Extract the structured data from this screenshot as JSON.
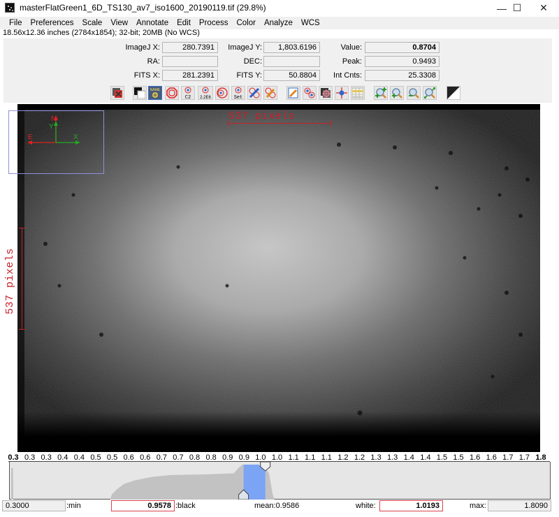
{
  "window": {
    "title": "masterFlatGreen1_6D_TS130_av7_iso1600_20190119.tif (29.8%)",
    "minimize": "—",
    "maximize": "☐",
    "close": "✕"
  },
  "menu": [
    "File",
    "Preferences",
    "Scale",
    "View",
    "Annotate",
    "Edit",
    "Process",
    "Color",
    "Analyze",
    "WCS"
  ],
  "info_line": "18.56x12.36 inches (2784x1854); 32-bit; 20MB (No WCS)",
  "coords": {
    "imagej_x_label": "ImageJ X:",
    "imagej_x": "280.7391",
    "imagej_y_label": "ImageJ Y:",
    "imagej_y": "1,803.6196",
    "value_label": "Value:",
    "value": "0.8704",
    "ra_label": "RA:",
    "ra": "",
    "dec_label": "DEC:",
    "dec": "",
    "peak_label": "Peak:",
    "peak": "0.9493",
    "fits_x_label": "FITS X:",
    "fits_x": "281.2391",
    "fits_y_label": "FITS Y:",
    "fits_y": "50.8804",
    "int_cnts_label": "Int Cnts:",
    "int_cnts": "25.3308"
  },
  "toolbar": {
    "icons": [
      "clear-overlay-icon",
      "color-swap-icon",
      "name-label-icon",
      "octagon-aperture-icon",
      "aperture-c2-icon",
      "aperture-2266-icon",
      "aperture-offset-icon",
      "aperture-set-icon",
      "edit-apertures-icon",
      "clear-apertures-icon",
      "clear-measurements-icon",
      "multi-aperture-icon",
      "align-stack-icon",
      "centroid-icon",
      "measurements-table-icon",
      "zoom-in-fit-icon",
      "zoom-in-icon",
      "zoom-out-icon",
      "zoom-fit-icon",
      "invert-icon"
    ],
    "c2_label": "C2",
    "e6_label": "2.2E6",
    "set_label": "Set",
    "name_label": "NAME"
  },
  "image": {
    "compass": {
      "north": "N",
      "east": "E",
      "x": "X",
      "y": "Y"
    },
    "scale_bar_horizontal": "537 pixels",
    "scale_bar_vertical": "537 pixels"
  },
  "histogram": {
    "tick_labels": [
      "0.3",
      "0.3",
      "0.3",
      "0.4",
      "0.4",
      "0.5",
      "0.5",
      "0.6",
      "0.6",
      "0.7",
      "0.7",
      "0.8",
      "0.8",
      "0.9",
      "0.9",
      "1.0",
      "1.0",
      "1.1",
      "1.1",
      "1.1",
      "1.2",
      "1.2",
      "1.3",
      "1.3",
      "1.4",
      "1.4",
      "1.5",
      "1.5",
      "1.6",
      "1.6",
      "1.7",
      "1.7",
      "1.8"
    ],
    "range_min": 0.3,
    "range_max": 1.809,
    "black_level": 0.9578,
    "white_level": 1.0193,
    "highlight_color": "#7ba4f5",
    "bar_color": "#c2c2c2"
  },
  "levels": {
    "min_value": "0.3000",
    "min_label": ":min",
    "black_value": "0.9578",
    "black_label": ":black",
    "mean_text": "mean:0.9586",
    "white_label": "white:",
    "white_value": "1.0193",
    "max_label": "max:",
    "max_value": "1.8090"
  }
}
